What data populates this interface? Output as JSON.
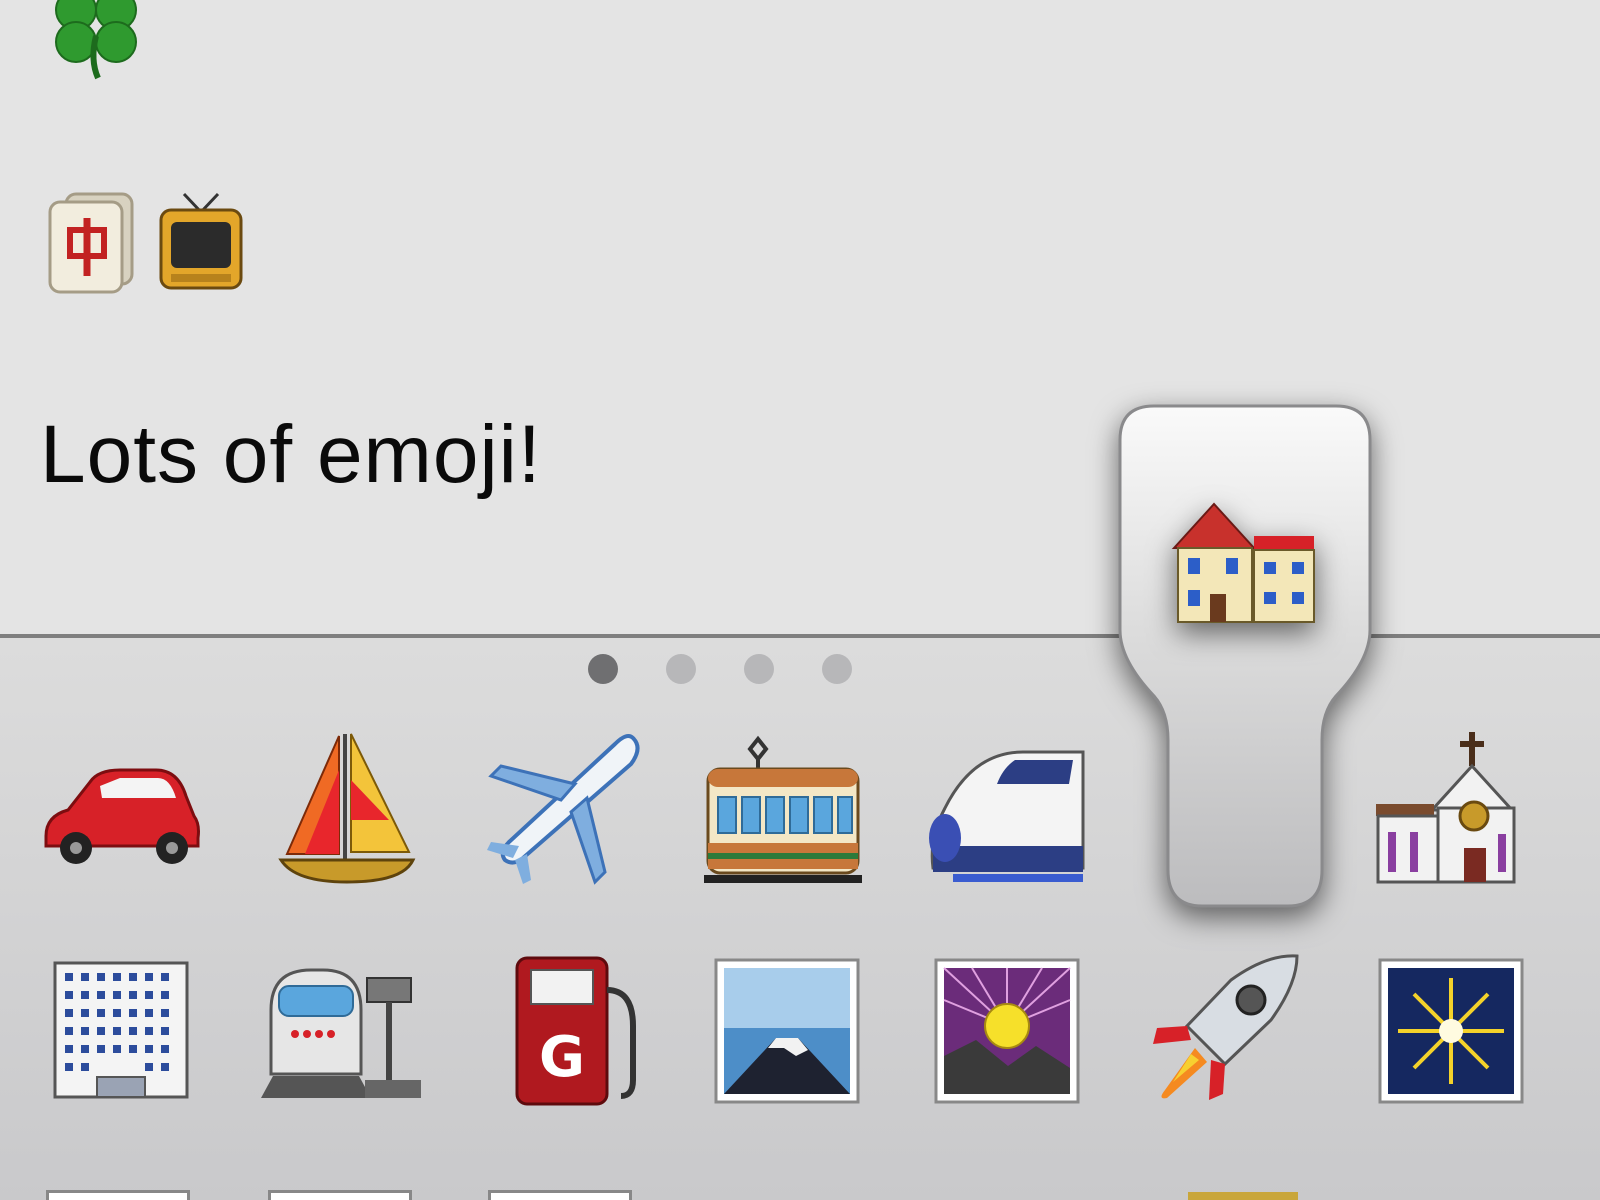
{
  "compose": {
    "emoji_line_1": [
      "four-leaf-clover"
    ],
    "emoji_line_2": [
      "mahjong-tile",
      "television"
    ],
    "text": "Lots of emoji!"
  },
  "keyboard": {
    "page_count": 4,
    "active_page": 1,
    "row1": [
      "red-car",
      "sailboat",
      "airplane",
      "tram-car",
      "bullet-train",
      "house",
      "church"
    ],
    "row2": [
      "office-building",
      "train-station",
      "fuel-pump",
      "mount-fuji",
      "sunrise-over-mountains",
      "rocket",
      "fireworks"
    ],
    "popout_key": "house"
  },
  "colors": {
    "compose_bg": "#e4e4e4",
    "keyboard_bg": "#d2d2d4",
    "active_dot": "#6f6f71",
    "inactive_dot": "#b7b7b9"
  }
}
